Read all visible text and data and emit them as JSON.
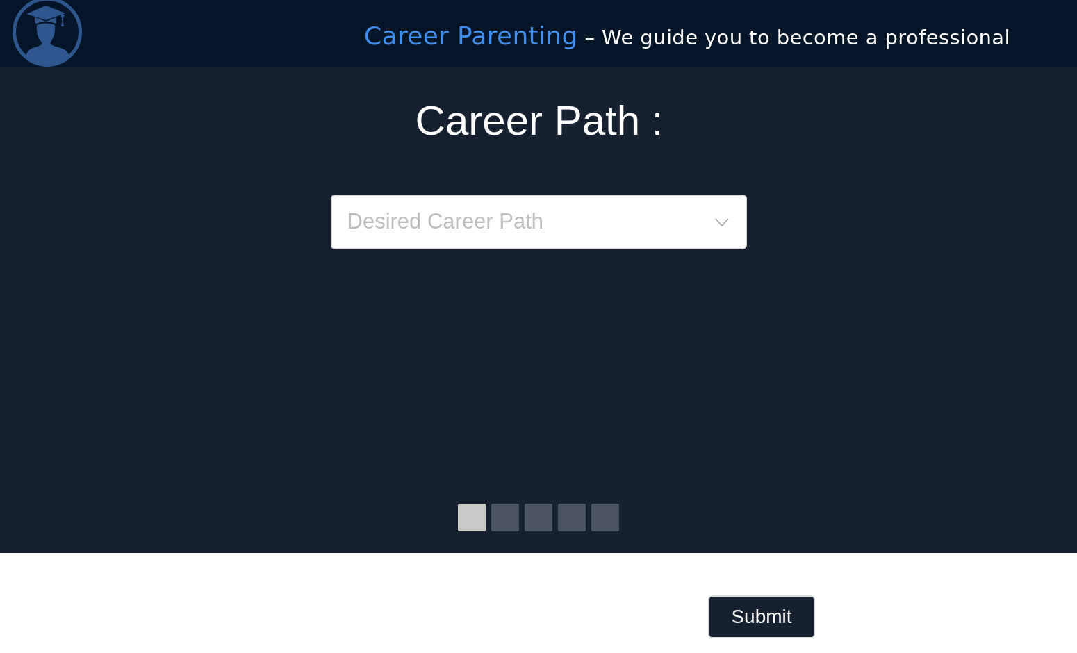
{
  "header": {
    "brand": "Career Parenting",
    "tagline": "– We guide you to become a professional"
  },
  "heading": "Career Path :",
  "career_select": {
    "placeholder": "Desired Career Path"
  },
  "steps": [
    {
      "selected": true
    },
    {
      "selected": false
    },
    {
      "selected": false
    },
    {
      "selected": false
    },
    {
      "selected": false
    }
  ],
  "submit_button": "Submit"
}
